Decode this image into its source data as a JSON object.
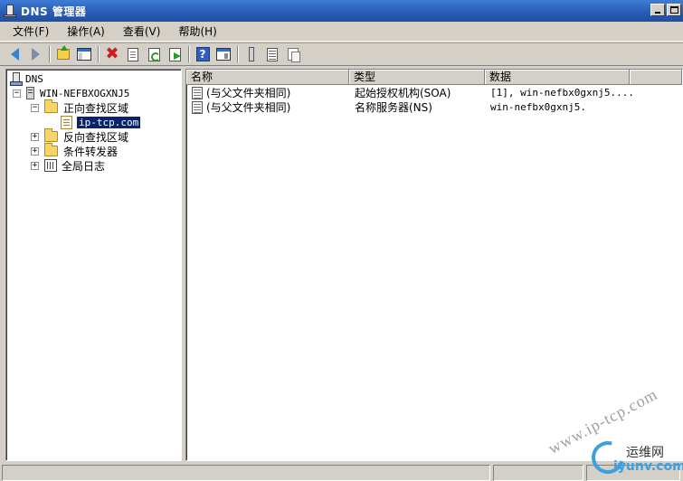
{
  "window": {
    "title": "DNS 管理器"
  },
  "menu": [
    {
      "label": "文件(F)"
    },
    {
      "label": "操作(A)"
    },
    {
      "label": "查看(V)"
    },
    {
      "label": "帮助(H)"
    }
  ],
  "tree": {
    "root": "DNS",
    "server": "WIN-NEFBXOGXNJ5",
    "forward_zones": "正向查找区域",
    "selected_zone": "ip-tcp.com",
    "reverse_zones": "反向查找区域",
    "conditional_forwarders": "条件转发器",
    "global_logs": "全局日志"
  },
  "list": {
    "columns": [
      "名称",
      "类型",
      "数据"
    ],
    "rows": [
      {
        "name": "(与父文件夹相同)",
        "type": "起始授权机构(SOA)",
        "data": "[1], win-nefbx0gxnj5...."
      },
      {
        "name": "(与父文件夹相同)",
        "type": "名称服务器(NS)",
        "data": "win-nefbx0gxnj5."
      }
    ]
  },
  "watermark": {
    "site": "www.ip-tcp.com",
    "brand_cn": "运维网",
    "brand_domain": "iyunv.com"
  },
  "colors": {
    "titlebar": "#2b5fb8",
    "selection": "#0a246a",
    "chrome": "#d4d0c8"
  }
}
